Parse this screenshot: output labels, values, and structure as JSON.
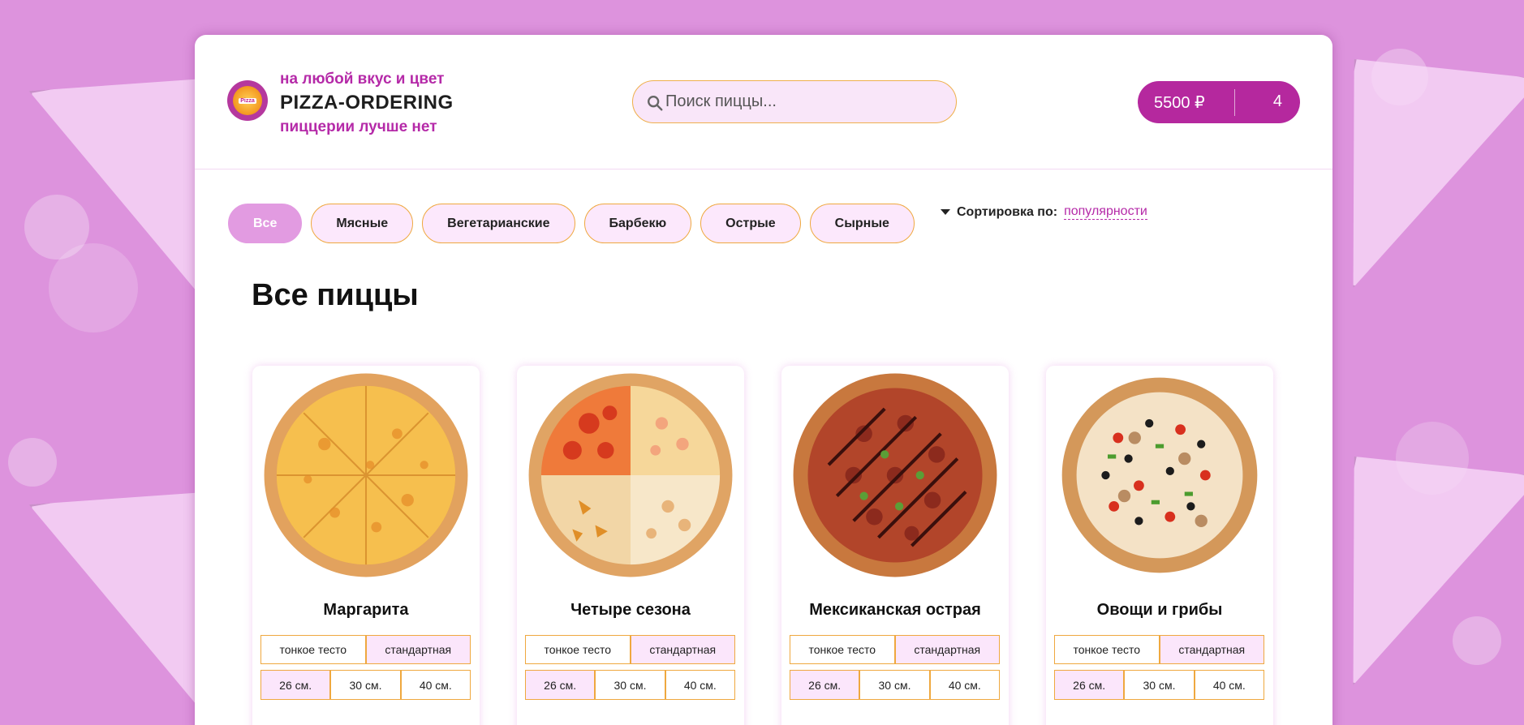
{
  "header": {
    "tagline_top": "на любой вкус и цвет",
    "brand": "PIZZA-ORDERING",
    "tagline_bottom": "пиццерии лучше нет",
    "logo_text": "Pizza"
  },
  "search": {
    "placeholder": "Поиск пиццы...",
    "value": ""
  },
  "cart": {
    "price": "5500 ₽",
    "count": "4"
  },
  "categories": [
    {
      "label": "Все",
      "active": true
    },
    {
      "label": "Мясные",
      "active": false
    },
    {
      "label": "Вегетарианские",
      "active": false
    },
    {
      "label": "Барбекю",
      "active": false
    },
    {
      "label": "Острые",
      "active": false
    },
    {
      "label": "Сырные",
      "active": false
    }
  ],
  "sort": {
    "label": "Сортировка по:",
    "value": "популярности"
  },
  "section_title": "Все пиццы",
  "pizzas": [
    {
      "name": "Маргарита",
      "dough": [
        "тонкое тесто",
        "стандартная"
      ],
      "sizes": [
        "26 см.",
        "30 см.",
        "40 см."
      ]
    },
    {
      "name": "Четыре сезона",
      "dough": [
        "тонкое тесто",
        "стандартная"
      ],
      "sizes": [
        "26 см.",
        "30 см.",
        "40 см."
      ]
    },
    {
      "name": "Мексиканская острая",
      "dough": [
        "тонкое тесто",
        "стандартная"
      ],
      "sizes": [
        "26 см.",
        "30 см.",
        "40 см."
      ]
    },
    {
      "name": "Овощи и грибы",
      "dough": [
        "тонкое тесто",
        "стандартная"
      ],
      "sizes": [
        "26 см.",
        "30 см.",
        "40 см."
      ]
    }
  ],
  "colors": {
    "accent": "#b5289e",
    "background": "#dd93dd",
    "border": "#efa83f",
    "active_category": "#e29be1"
  }
}
